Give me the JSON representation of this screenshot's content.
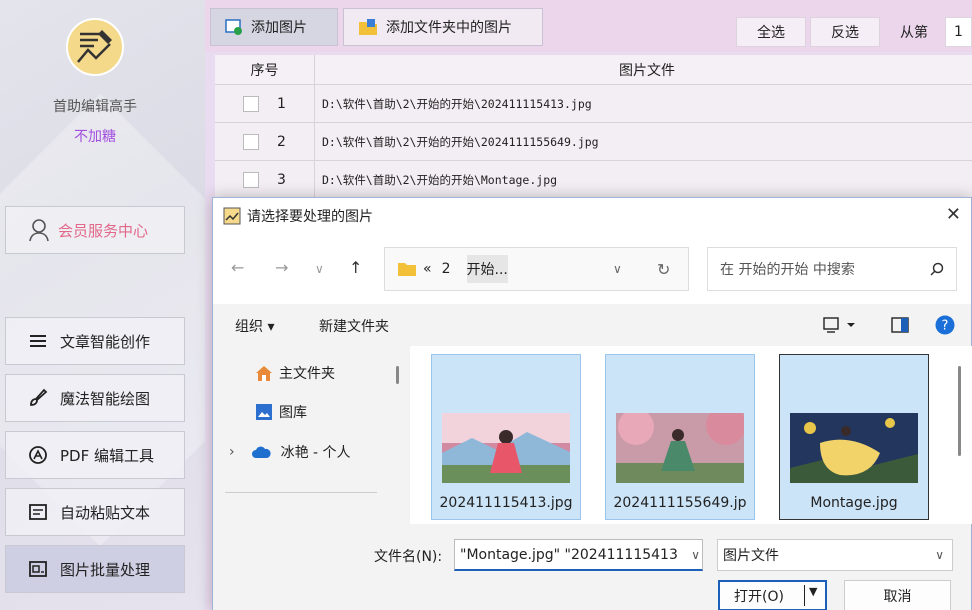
{
  "sidebar": {
    "app_name": "首助编辑高手",
    "subtitle": "不加糖",
    "member_label": "会员服务中心",
    "nav": [
      {
        "label": "文章智能创作",
        "icon": "menu-lines-icon"
      },
      {
        "label": "魔法智能绘图",
        "icon": "brush-icon"
      },
      {
        "label": "PDF 编辑工具",
        "icon": "pdf-icon"
      },
      {
        "label": "自动粘贴文本",
        "icon": "paste-icon"
      },
      {
        "label": "图片批量处理",
        "icon": "image-batch-icon"
      }
    ],
    "active_index": 4
  },
  "toolbar": {
    "add_image": "添加图片",
    "add_folder_images": "添加文件夹中的图片",
    "select_all": "全选",
    "invert": "反选",
    "from_label": "从第",
    "from_value": "1"
  },
  "grid": {
    "headers": [
      "序号",
      "图片文件"
    ],
    "rows": [
      {
        "index": "1",
        "path": "D:\\软件\\首助\\2\\开始的开始\\202411115413.jpg"
      },
      {
        "index": "2",
        "path": "D:\\软件\\首助\\2\\开始的开始\\2024111155649.jpg"
      },
      {
        "index": "3",
        "path": "D:\\软件\\首助\\2\\开始的开始\\Montage.jpg"
      }
    ]
  },
  "dialog": {
    "title": "请选择要处理的图片",
    "breadcrumb": {
      "prefix": "«",
      "parts": [
        "2",
        "开始..."
      ]
    },
    "search_placeholder": "在 开始的开始 中搜索",
    "organize": "组织 ▾",
    "new_folder": "新建文件夹",
    "tree": [
      "主文件夹",
      "图库",
      "冰艳 - 个人"
    ],
    "files": [
      {
        "name": "202411115413.jpg"
      },
      {
        "name": "2024111155649.jp"
      },
      {
        "name": "Montage.jpg"
      }
    ],
    "filename_label": "文件名(N):",
    "filename_value": "\"Montage.jpg\" \"202411115413",
    "filetype": "图片文件",
    "open": "打开(O)",
    "cancel": "取消"
  },
  "colors": {
    "accent": "#1b5fb8",
    "sugar": "#a24fe0",
    "member": "#e2688a",
    "selected_tile": "#cce4f7"
  }
}
